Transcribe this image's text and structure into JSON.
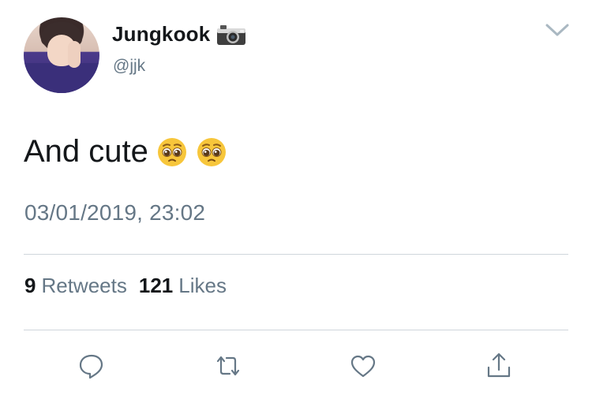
{
  "author": {
    "display_name": "Jungkook",
    "handle": "@jjk",
    "name_badge_icon": "camera-icon"
  },
  "tweet": {
    "text": "And cute",
    "emojis": [
      "pleading-face-emoji",
      "pleading-face-emoji"
    ],
    "timestamp": "03/01/2019, 23:02"
  },
  "stats": {
    "retweets_count": "9",
    "retweets_label": "Retweets",
    "likes_count": "121",
    "likes_label": "Likes"
  },
  "actions": [
    "reply-icon",
    "retweet-icon",
    "like-icon",
    "share-icon"
  ],
  "colors": {
    "text_primary": "#14171a",
    "text_secondary": "#657786",
    "icon": "#657786",
    "divider": "#cfd6dc"
  }
}
